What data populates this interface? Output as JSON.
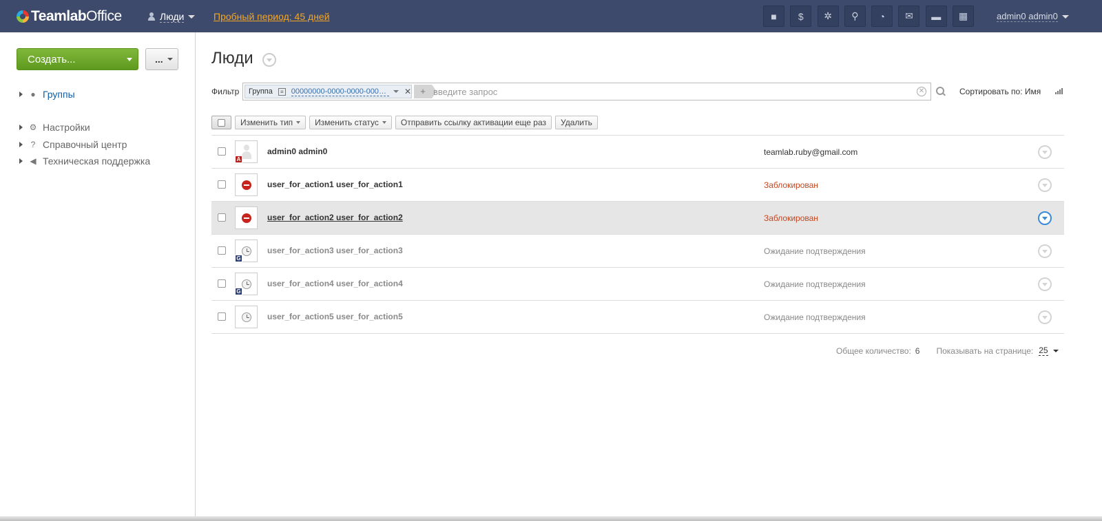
{
  "topbar": {
    "logo_bold": "Teamlab",
    "logo_rest": "Office",
    "module_label": "Люди",
    "trial_text": "Пробный период: 45 дней",
    "icons": [
      "video-icon",
      "money-icon",
      "settings-icon",
      "search-icon",
      "feed-icon",
      "mail-icon",
      "chat-icon",
      "calendar-icon"
    ],
    "icon_glyphs": [
      "■",
      "$",
      "✲",
      "⚲",
      "◔",
      "✉",
      "▬",
      "▦"
    ],
    "user_name": "admin0 admin0"
  },
  "sidebar": {
    "create_label": "Создать...",
    "more_label": "...",
    "groups_label": "Группы",
    "settings_label": "Настройки",
    "help_label": "Справочный центр",
    "support_label": "Техническая поддержка"
  },
  "main": {
    "title": "Люди",
    "filter": {
      "label": "Фильтр",
      "tag_name": "Группа",
      "tag_value": "00000000-0000-0000-0000-...",
      "plus": "+",
      "placeholder": "введите запрос"
    },
    "sort_label": "Сортировать по: Имя",
    "actions": {
      "change_type": "Изменить тип",
      "change_status": "Изменить статус",
      "resend": "Отправить ссылку активации еще раз",
      "delete": "Удалить"
    },
    "people": [
      {
        "name": "admin0 admin0",
        "info": "teamlab.ruby@gmail.com"
      },
      {
        "name": "user_for_action1 user_for_action1",
        "info": "Заблокирован"
      },
      {
        "name": "user_for_action2 user_for_action2",
        "info": "Заблокирован"
      },
      {
        "name": "user_for_action3 user_for_action3",
        "info": "Ожидание подтверждения"
      },
      {
        "name": "user_for_action4 user_for_action4",
        "info": "Ожидание подтверждения"
      },
      {
        "name": "user_for_action5 user_for_action5",
        "info": "Ожидание подтверждения"
      }
    ],
    "badges": {
      "admin": "A",
      "guest": "G"
    },
    "pager": {
      "total_label": "Общее количество:",
      "total": "6",
      "per_page_label": "Показывать на странице:",
      "per_page": "25"
    }
  },
  "colors": {
    "topbar": "#3d4a6b",
    "create_button": "#6aa82a",
    "blocked_text": "#c6451d",
    "link_blue": "#0f5ea4",
    "trial_orange": "#f5a623"
  }
}
